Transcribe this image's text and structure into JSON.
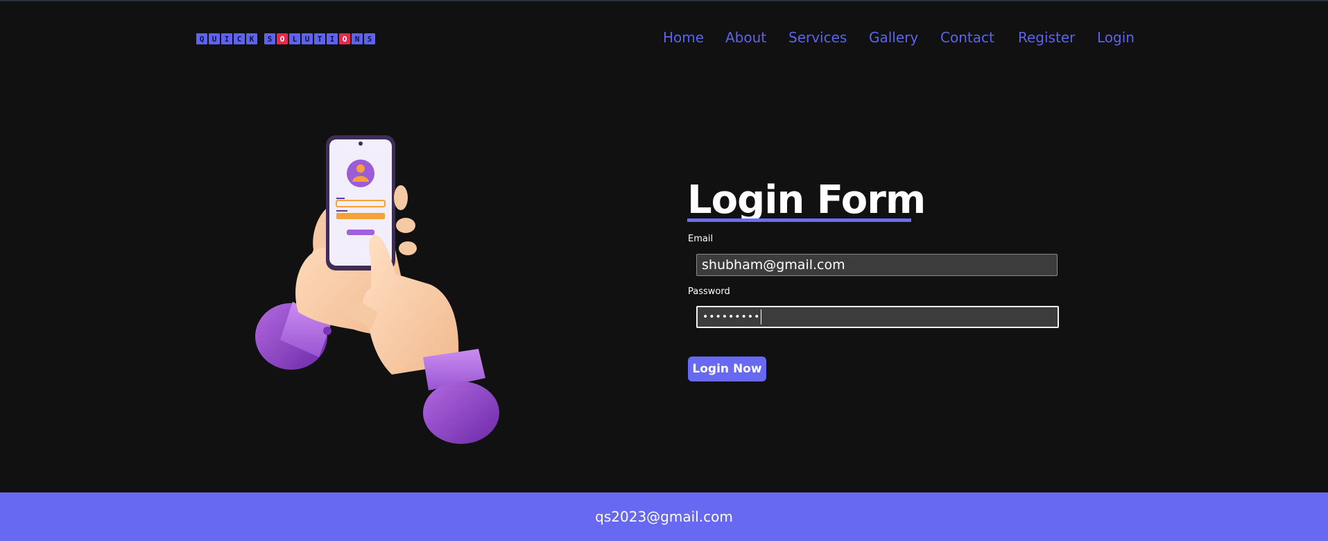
{
  "brand": {
    "tiles": [
      {
        "char": "Q",
        "color": "#5d63ec"
      },
      {
        "char": "U",
        "color": "#5d63ec"
      },
      {
        "char": "I",
        "color": "#5d63ec"
      },
      {
        "char": "C",
        "color": "#5d63ec"
      },
      {
        "char": "K",
        "color": "#5d63ec"
      },
      {
        "char": "",
        "color": "transparent"
      },
      {
        "char": "S",
        "color": "#5d63ec"
      },
      {
        "char": "O",
        "color": "#e8294e"
      },
      {
        "char": "L",
        "color": "#5d63ec"
      },
      {
        "char": "U",
        "color": "#5d63ec"
      },
      {
        "char": "T",
        "color": "#5d63ec"
      },
      {
        "char": "I",
        "color": "#5d63ec"
      },
      {
        "char": "O",
        "color": "#e8294e"
      },
      {
        "char": "N",
        "color": "#5d63ec"
      },
      {
        "char": "S",
        "color": "#5d63ec"
      }
    ]
  },
  "nav": {
    "items": [
      "Home",
      "About",
      "Services",
      "Gallery",
      "Contact",
      "Register",
      "Login"
    ]
  },
  "form": {
    "title": "Login Form",
    "email_label": "Email",
    "email_value": "shubham@gmail.com",
    "password_label": "Password",
    "password_value": "•••••••••",
    "submit_label": "Login Now"
  },
  "footer": {
    "email": "qs2023@gmail.com"
  },
  "colors": {
    "accent": "#6769f2",
    "background": "#111112",
    "nav_text": "#5e63ef"
  },
  "icons": {
    "illustration": "hand-holding-phone-login-illustration"
  }
}
